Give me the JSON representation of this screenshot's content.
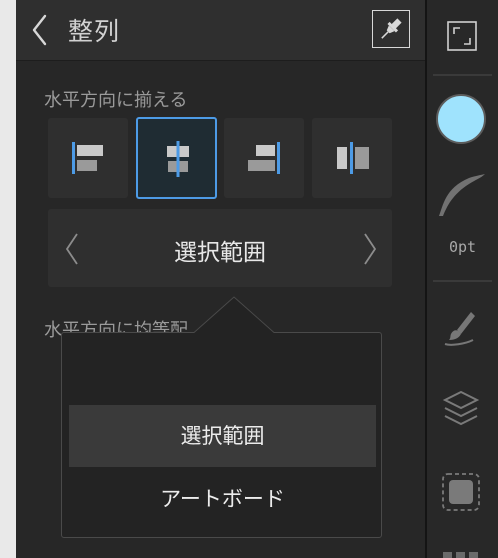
{
  "header": {
    "title": "整列"
  },
  "alignment": {
    "horizontal_label": "水平方向に揃える",
    "distribute_label": "水平方向に均等配",
    "selected_index": 1
  },
  "target": {
    "value": "選択範囲"
  },
  "popover": {
    "options": [
      "選択範囲",
      "アートボード"
    ],
    "selected": "選択範囲"
  },
  "rightbar": {
    "fill_color": "#9fe3fd",
    "stroke_width": "0pt"
  },
  "colors": {
    "accent": "#4d9be6",
    "panel_bg": "#272727"
  }
}
